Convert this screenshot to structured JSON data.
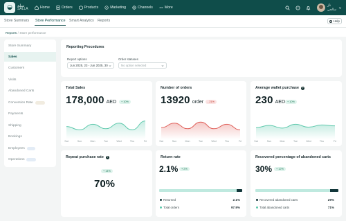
{
  "brand": {
    "logo_icon": "bag-icon",
    "name_ar": "سلة",
    "name_en": "SALLA"
  },
  "nav": {
    "items": [
      {
        "icon": "home-icon",
        "label": "Home"
      },
      {
        "icon": "orders-icon",
        "label": "Orders"
      },
      {
        "icon": "products-icon",
        "label": "Products"
      },
      {
        "icon": "marketing-icon",
        "label": "Marketing"
      },
      {
        "icon": "channels-icon",
        "label": "Channels"
      },
      {
        "icon": "more-icon",
        "label": "More"
      }
    ],
    "user": {
      "name_ar": "ناز",
      "subtitle": "سالحي"
    }
  },
  "tabs": [
    "Store Summary",
    "Store Performance",
    "Smart Analytics",
    "Reports"
  ],
  "active_tab": "Store Performance",
  "help_label": "Help",
  "breadcrumb": {
    "root": "Reports",
    "separator": "/",
    "current": "Store performance"
  },
  "sidebar": {
    "items": [
      {
        "label": "Store Summary"
      },
      {
        "label": "Sales"
      },
      {
        "label": "Customers"
      },
      {
        "label": "Visits"
      },
      {
        "label": "Abandoned Carts"
      },
      {
        "label": "Conversion Rate"
      },
      {
        "label": "Payments"
      },
      {
        "label": "Shipping"
      },
      {
        "label": "Bookings"
      },
      {
        "label": "Employees"
      },
      {
        "label": "Operations"
      }
    ],
    "active": "Sales"
  },
  "filters": {
    "title": "Reporting Procedures",
    "period_label": "Report options",
    "period_value": "Jun 2025, 23 - Jun 2025, 30",
    "status_label": "Order statuses",
    "status_placeholder": "No option selected"
  },
  "cards": {
    "total_sales": {
      "title": "Total Sales",
      "value": "178,000",
      "unit": "AED",
      "change": "+ 10%"
    },
    "orders": {
      "title": "Number of orders",
      "value": "13920",
      "unit": "order",
      "change": "- 21%"
    },
    "avg_wallet": {
      "title": "Average wallet purchase",
      "value": "230",
      "unit": "AED",
      "change": "+ 10%"
    },
    "repeat_rate": {
      "title": "Repeat purchase rate",
      "value": "70%",
      "change": "+ 14%"
    },
    "return_rate": {
      "title": "Return rate",
      "value": "2.1%",
      "change": "+ 2%",
      "rows": [
        {
          "label": "Returned",
          "value": "2.1%"
        },
        {
          "label": "Total orders",
          "value": "97.9%"
        }
      ],
      "bar_fraction": 0.07
    },
    "abandoned": {
      "title": "Recovered percentage of abandoned carts",
      "value": "30%",
      "change": "+ 12%",
      "rows": [
        {
          "label": "Recovered abandoned carts",
          "value": "29%"
        },
        {
          "label": "Total abandoned carts",
          "value": "71%"
        }
      ],
      "bar_fraction": 0.1
    }
  },
  "days": [
    "Sat",
    "Sun",
    "Mon",
    "Tue",
    "Wed",
    "Thu",
    "Fri"
  ],
  "colors": {
    "primary": "#0f4d4a",
    "up": "#5fc9ad",
    "down": "#e0605a",
    "bar_track": "#bfe9df",
    "bar_fill": "#12363a"
  },
  "chart_data": [
    {
      "type": "area",
      "categories": [
        "Sat",
        "Sun",
        "Mon",
        "Tue",
        "Wed",
        "Thu",
        "Fri"
      ],
      "series": [
        {
          "values": [
            45,
            30,
            55,
            35,
            60,
            30,
            70
          ]
        }
      ]
    },
    {
      "type": "area",
      "categories": [
        "Sat",
        "Sun",
        "Mon",
        "Tue",
        "Wed",
        "Thu",
        "Fri"
      ],
      "series": [
        {
          "values": [
            40,
            60,
            35,
            65,
            35,
            55,
            30
          ]
        }
      ]
    },
    {
      "type": "area",
      "categories": [
        "Sat",
        "Sun",
        "Mon",
        "Tue",
        "Wed",
        "Thu",
        "Fri"
      ],
      "series": [
        {
          "values": [
            40,
            50,
            38,
            55,
            42,
            52,
            48
          ]
        }
      ]
    }
  ]
}
